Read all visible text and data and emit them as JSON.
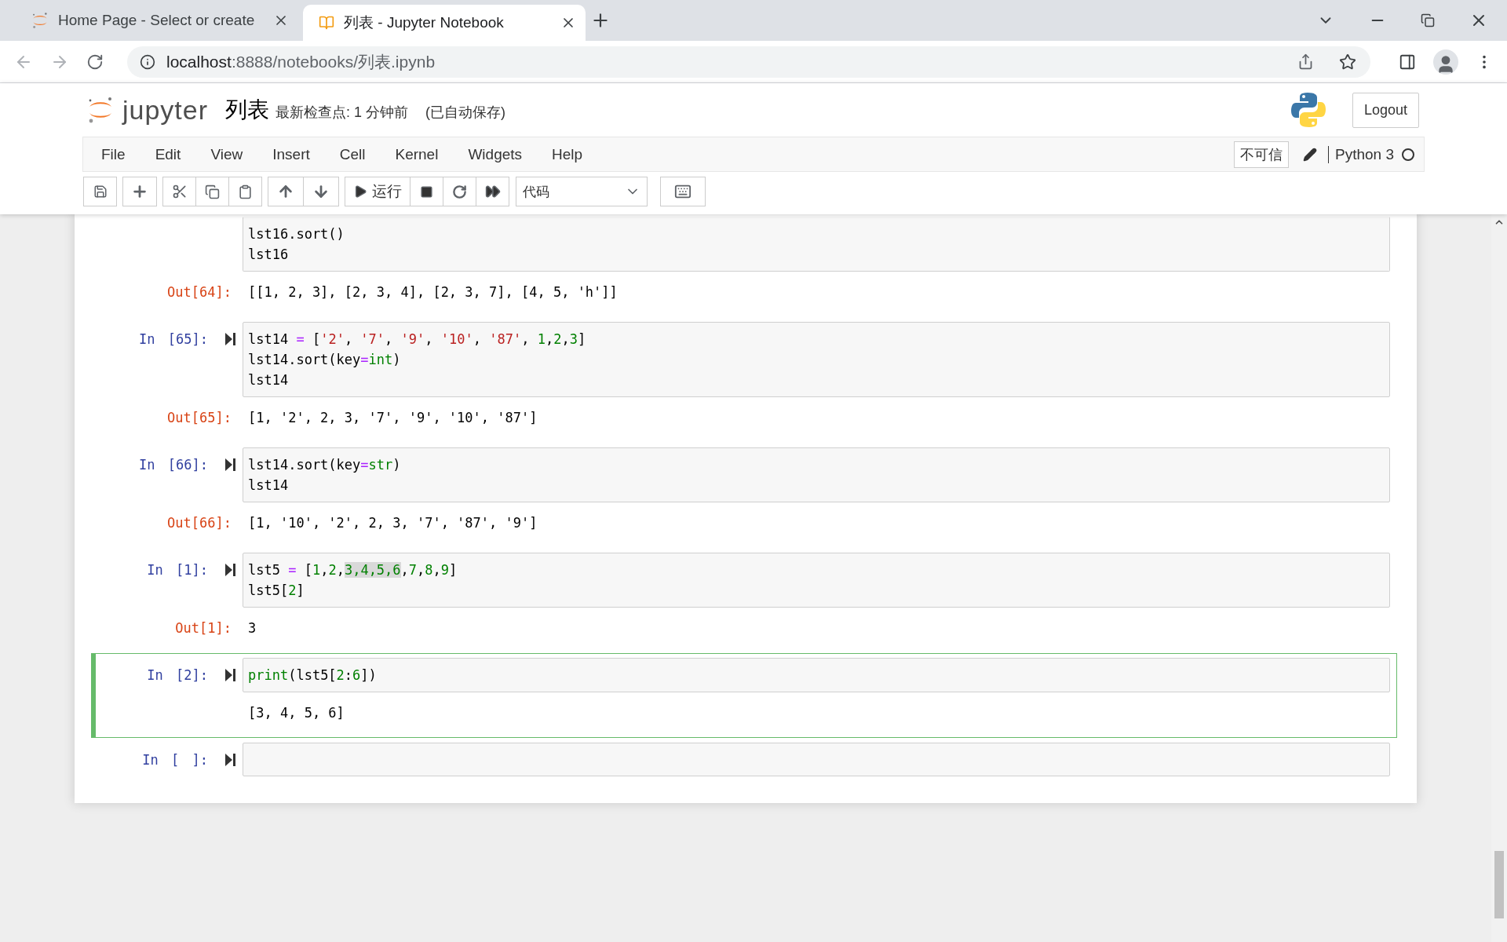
{
  "browser": {
    "tabs": [
      {
        "title": "Home Page - Select or create",
        "selected": false
      },
      {
        "title": "列表 - Jupyter Notebook",
        "selected": true
      }
    ],
    "url_host": "localhost",
    "url_path": ":8888/notebooks/列表.ipynb"
  },
  "header": {
    "logo_text": "jupyter",
    "notebook_name": "列表",
    "checkpoint": "最新检查点: 1 分钟前",
    "autosave": "(已自动保存)",
    "logout": "Logout"
  },
  "menu": [
    "File",
    "Edit",
    "View",
    "Insert",
    "Cell",
    "Kernel",
    "Widgets",
    "Help"
  ],
  "trust": "不可信",
  "kernel": "Python 3",
  "kernel_busy": false,
  "toolbar": {
    "run": "运行",
    "cell_type": "代码"
  },
  "cells": [
    {
      "selected": false,
      "lines": [
        [
          {
            "kind": "plain",
            "text": "lst16.sort()"
          }
        ],
        [
          {
            "kind": "plain",
            "text": "lst16"
          }
        ]
      ],
      "output": {
        "prompt": "Out[64]:",
        "text": "[[1, 2, 3], [2, 3, 4], [2, 3, 7], [4, 5, 'h']]"
      }
    },
    {
      "selected": false,
      "prompt": "In [65]:",
      "lines": [
        [
          {
            "kind": "plain",
            "text": "lst14 "
          },
          {
            "kind": "op",
            "text": "="
          },
          {
            "kind": "plain",
            "text": " ["
          },
          {
            "kind": "str",
            "text": "'2'"
          },
          {
            "kind": "plain",
            "text": ", "
          },
          {
            "kind": "str",
            "text": "'7'"
          },
          {
            "kind": "plain",
            "text": ", "
          },
          {
            "kind": "str",
            "text": "'9'"
          },
          {
            "kind": "plain",
            "text": ", "
          },
          {
            "kind": "str",
            "text": "'10'"
          },
          {
            "kind": "plain",
            "text": ", "
          },
          {
            "kind": "str",
            "text": "'87'"
          },
          {
            "kind": "plain",
            "text": ", "
          },
          {
            "kind": "num",
            "text": "1"
          },
          {
            "kind": "plain",
            "text": ","
          },
          {
            "kind": "num",
            "text": "2"
          },
          {
            "kind": "plain",
            "text": ","
          },
          {
            "kind": "num",
            "text": "3"
          },
          {
            "kind": "plain",
            "text": "]"
          }
        ],
        [
          {
            "kind": "plain",
            "text": "lst14.sort(key"
          },
          {
            "kind": "op",
            "text": "="
          },
          {
            "kind": "builtin",
            "text": "int"
          },
          {
            "kind": "plain",
            "text": ")"
          }
        ],
        [
          {
            "kind": "plain",
            "text": "lst14"
          }
        ]
      ],
      "output": {
        "prompt": "Out[65]:",
        "text": "[1, '2', 2, 3, '7', '9', '10', '87']"
      }
    },
    {
      "selected": false,
      "prompt": "In [66]:",
      "lines": [
        [
          {
            "kind": "plain",
            "text": "lst14.sort(key"
          },
          {
            "kind": "op",
            "text": "="
          },
          {
            "kind": "builtin",
            "text": "str"
          },
          {
            "kind": "plain",
            "text": ")"
          }
        ],
        [
          {
            "kind": "plain",
            "text": "lst14"
          }
        ]
      ],
      "output": {
        "prompt": "Out[66]:",
        "text": "[1, '10', '2', 2, 3, '7', '87', '9']"
      }
    },
    {
      "selected": false,
      "prompt": "In [1]:",
      "lines": [
        [
          {
            "kind": "plain",
            "text": "lst5 "
          },
          {
            "kind": "op",
            "text": "="
          },
          {
            "kind": "plain",
            "text": " ["
          },
          {
            "kind": "num",
            "text": "1"
          },
          {
            "kind": "plain",
            "text": ","
          },
          {
            "kind": "num",
            "text": "2"
          },
          {
            "kind": "plain",
            "text": ","
          },
          {
            "kind": "sel",
            "text": "3,4,5,6"
          },
          {
            "kind": "plain",
            "text": ","
          },
          {
            "kind": "num",
            "text": "7"
          },
          {
            "kind": "plain",
            "text": ","
          },
          {
            "kind": "num",
            "text": "8"
          },
          {
            "kind": "plain",
            "text": ","
          },
          {
            "kind": "num",
            "text": "9"
          },
          {
            "kind": "plain",
            "text": "]"
          }
        ],
        [
          {
            "kind": "plain",
            "text": "lst5["
          },
          {
            "kind": "num",
            "text": "2"
          },
          {
            "kind": "plain",
            "text": "]"
          }
        ]
      ],
      "output": {
        "prompt": "Out[1]:",
        "text": "3"
      }
    },
    {
      "selected": true,
      "prompt": "In [2]:",
      "lines": [
        [
          {
            "kind": "builtin",
            "text": "print"
          },
          {
            "kind": "plain",
            "text": "(lst5["
          },
          {
            "kind": "num",
            "text": "2"
          },
          {
            "kind": "plain",
            "text": ":"
          },
          {
            "kind": "num",
            "text": "6"
          },
          {
            "kind": "plain",
            "text": "])"
          }
        ]
      ],
      "output": {
        "text": "[3, 4, 5, 6]"
      }
    },
    {
      "selected": false,
      "prompt": "In [ ]:"
    }
  ]
}
